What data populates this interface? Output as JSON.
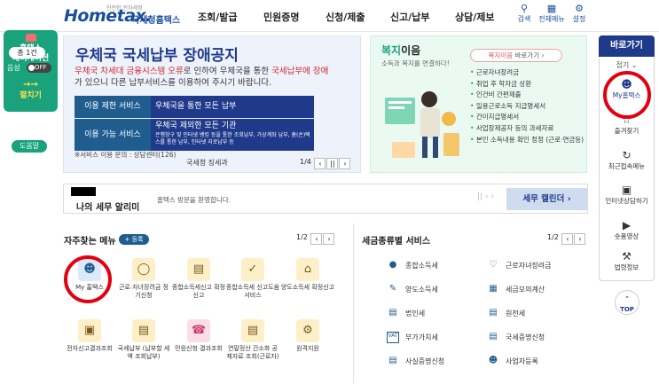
{
  "header": {
    "logo_small": "안전한 전자세정",
    "logo_main": "Hometax.",
    "logo_sub": "국세청홈택스",
    "nav": [
      "조회/발급",
      "민원증명",
      "신청/제출",
      "신고/납부",
      "상담/제보"
    ],
    "tools": [
      {
        "label": "검색",
        "icon": "search-icon"
      },
      {
        "label": "전체메뉴",
        "icon": "grid-menu-icon"
      },
      {
        "label": "설정",
        "icon": "gear-icon"
      }
    ]
  },
  "left_widget": {
    "title1": "홈택스",
    "title2": "내비게이션",
    "count": "총 1건",
    "sound_label": "음성",
    "sound_state": "OFF",
    "expand_label": "펼치기",
    "help": "도움말"
  },
  "notice": {
    "title": "우체국 국세납부 장애공지",
    "text_red1": "우체국 차세대 금융시스템 오류",
    "text_mid": "로 인하여 우체국을 통한 ",
    "text_red2": "국세납부에 장애",
    "text_end": "가 있으니 다른 납부서비스를 이용하여 주시기 바랍니다.",
    "row1_label": "이용 제한 서비스",
    "row1_value": "우체국을 통한 모든 납부",
    "row2_label": "이용 가능 서비스",
    "row2_value": "우체국 제외한 모든 기관",
    "row2_detail": "은행창구 및 인터넷 뱅킹 등을 통한 조회납부, 가상계좌 납부, 홈(손)택스를 통한 납부, 인터넷 지로납부 등",
    "contact": "※서비스 이용 문의 : 상담센터(126)",
    "footer": "국세청 징세과",
    "page": "1/4"
  },
  "welfare": {
    "title_hl": "복지",
    "title_rest": "이음",
    "subtitle": "소득과 복지를 연결하다!",
    "button_hl": "복지이음",
    "button_rest": " 바로가기",
    "items": [
      "근로자녀장려금",
      "취업 후 학자금 상환",
      "인건비 간편제출",
      "일용근로소득 지급명세서",
      "간이지급명세서",
      "사업장제공자 등의 과세자료",
      "본인 소득내용 확인 정정 (근로·연금등)"
    ]
  },
  "alert": {
    "title": "나의 세무 알리미",
    "greeting": "홈택스 방문을 환영합니다.",
    "pager": "|| ‹ ›",
    "calendar": "세무 캘린더"
  },
  "frequent": {
    "title": "자주찾는 메뉴",
    "register": "+ 등록",
    "page": "1/2",
    "items": [
      {
        "label": "My 홈택스",
        "icon": "person-icon"
      },
      {
        "label": "근로·자녀장려금 정기신청",
        "icon": "coin-bag-icon"
      },
      {
        "label": "종합소득세신고 확정신고",
        "icon": "document-icon"
      },
      {
        "label": "종합소득세 신고도움 서비스",
        "icon": "document-check-icon"
      },
      {
        "label": "양도소득세 확정신고",
        "icon": "house-icon"
      },
      {
        "label": "전자신고결과조회",
        "icon": "monitor-icon"
      },
      {
        "label": "국세납부 (납부할 세액 조회납부)",
        "icon": "tax-bill-icon"
      },
      {
        "label": "민원신청 결과조회",
        "icon": "phone-icon"
      },
      {
        "label": "연말정산 간소화 공제자료 조회(근로자)",
        "icon": "calendar-icon"
      },
      {
        "label": "원격지원",
        "icon": "support-icon"
      }
    ]
  },
  "taxtype": {
    "title": "세금종류별 서비스",
    "page": "1/2",
    "items": [
      {
        "label": "종합소득세",
        "icon": "coins-icon"
      },
      {
        "label": "근로자녀장려금",
        "icon": "heart-hands-icon"
      },
      {
        "label": "양도소득세",
        "icon": "document-pen-icon"
      },
      {
        "label": "세금모의계산",
        "icon": "calculator-icon"
      },
      {
        "label": "법인세",
        "icon": "building-icon"
      },
      {
        "label": "원천세",
        "icon": "receipt-icon"
      },
      {
        "label": "부가가치세",
        "icon": "vat-icon"
      },
      {
        "label": "국세증명신청",
        "icon": "certificate-icon"
      },
      {
        "label": "사실증명신청",
        "icon": "document-icon"
      },
      {
        "label": "사업자등록",
        "icon": "person-badge-icon"
      }
    ]
  },
  "quick": {
    "title": "바로가기",
    "fold": "접기",
    "items": [
      {
        "label": "My홈택스",
        "icon": "person-icon"
      },
      {
        "label": "즐겨찾기",
        "icon": "star-icon"
      },
      {
        "label": "최근접속메뉴",
        "icon": "history-icon"
      },
      {
        "label": "인터넷상담하기",
        "icon": "chat-monitor-icon"
      },
      {
        "label": "숏폼영상",
        "icon": "play-icon"
      },
      {
        "label": "법령정보",
        "icon": "gavel-icon"
      }
    ],
    "top": "TOP"
  }
}
